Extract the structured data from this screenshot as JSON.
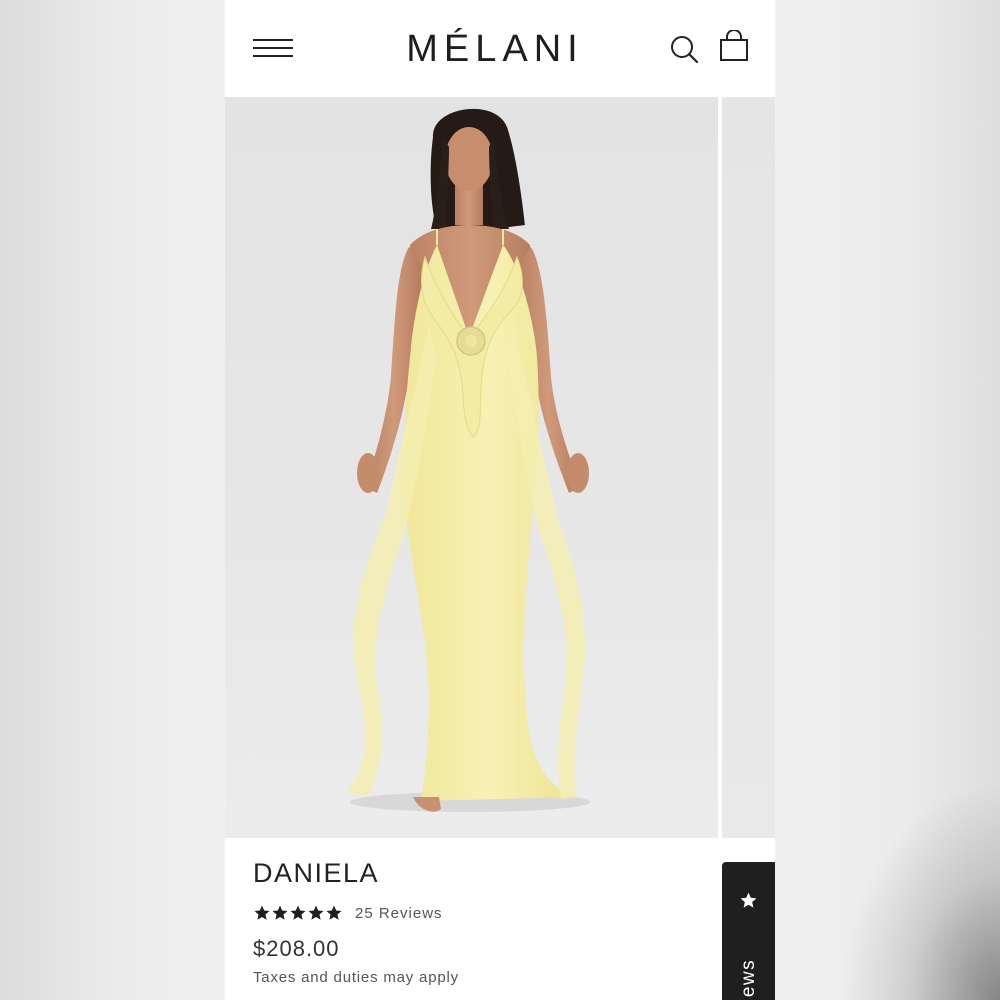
{
  "header": {
    "logo": "MÉLANI",
    "menu_icon": "hamburger-menu-icon",
    "search_icon": "search-icon",
    "cart_icon": "shopping-bag-icon"
  },
  "gallery": {
    "current_image": "model-wearing-yellow-ruffle-maxi-dress",
    "next_image_peek": true
  },
  "product": {
    "name": "DANIELA",
    "rating": 5,
    "rating_max": 5,
    "reviews_label": "25 Reviews",
    "price": "$208.00",
    "tax_note": "Taxes and duties may apply"
  },
  "reviews_tab": {
    "label": "Reviews",
    "icon": "star-icon"
  },
  "colors": {
    "text": "#222222",
    "dress": "#f4eeaa",
    "tab_background": "#1f1f1f",
    "photo_background": "#e5e5e5"
  }
}
